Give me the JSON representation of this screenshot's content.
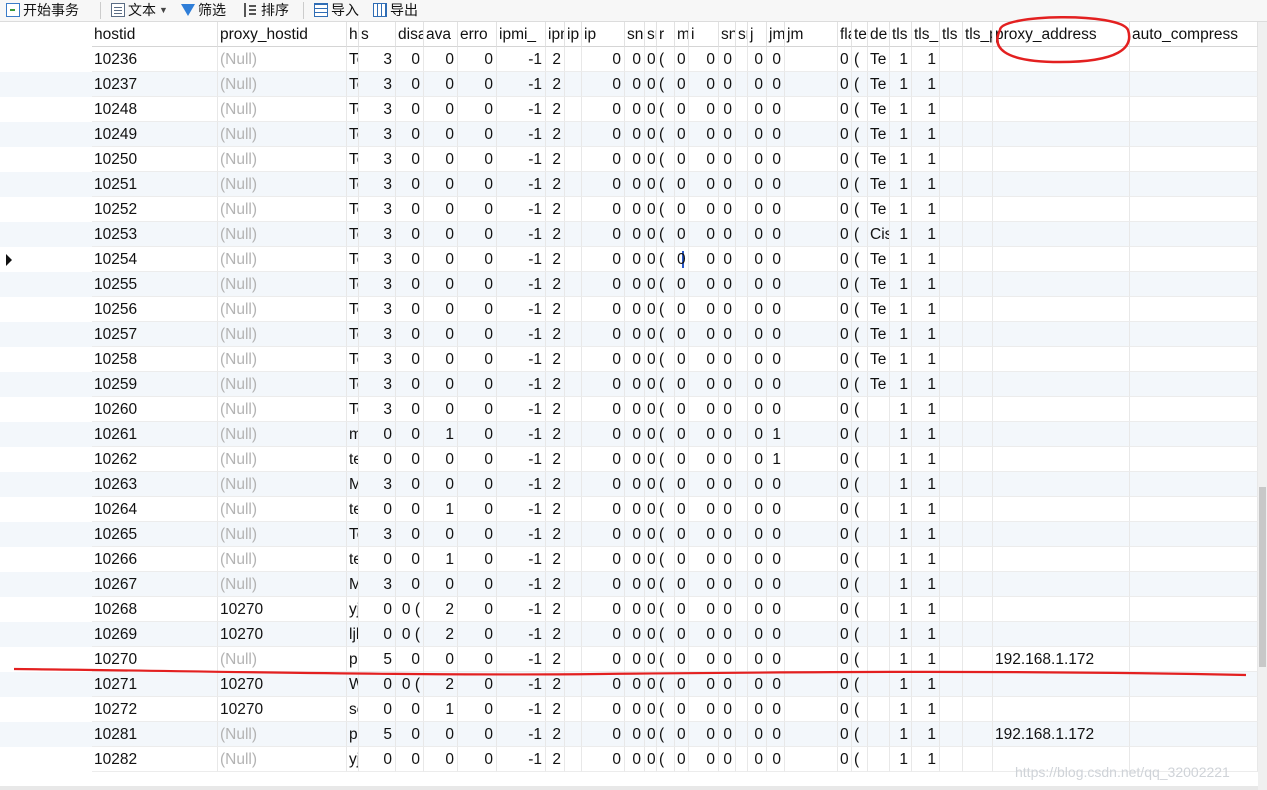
{
  "toolbar": {
    "begin_tx": "开始事务",
    "text": "文本",
    "filter": "筛选",
    "sort": "排序",
    "import": "导入",
    "export": "导出"
  },
  "columns": [
    "hostid",
    "proxy_hostid",
    "host",
    "s",
    "disa",
    "ava",
    "erro",
    "ipmi_",
    "ipmi_p",
    "ip",
    "ip",
    "snmp",
    "sn",
    "r",
    "m",
    "i",
    "snm",
    "sr",
    "j",
    "jm",
    "jm",
    "flag",
    "te",
    "de",
    "tls",
    "tls_",
    "tls",
    "tls_p",
    "proxy_address",
    "auto_compress"
  ],
  "rows": [
    [
      "10236",
      "(Null)",
      "Template Net TP-",
      "3",
      "0",
      "0",
      "0",
      "-1",
      "2",
      "",
      "0",
      "0",
      "0",
      "(",
      "0",
      "0",
      "0",
      "",
      "0",
      "0",
      "",
      "0",
      "(",
      "Te",
      "1",
      "1",
      "",
      "",
      "",
      ""
    ],
    [
      "10237",
      "(Null)",
      "Template Net Ub",
      "3",
      "0",
      "0",
      "0",
      "-1",
      "2",
      "",
      "0",
      "0",
      "0",
      "(",
      "0",
      "0",
      "0",
      "",
      "0",
      "0",
      "",
      "0",
      "(",
      "Te",
      "1",
      "1",
      "",
      "",
      "",
      ""
    ],
    [
      "10248",
      "(Null)",
      "Template OS Linu",
      "3",
      "0",
      "0",
      "0",
      "-1",
      "2",
      "",
      "0",
      "0",
      "0",
      "(",
      "0",
      "0",
      "0",
      "",
      "0",
      "0",
      "",
      "0",
      "(",
      "Te",
      "1",
      "1",
      "",
      "",
      "",
      ""
    ],
    [
      "10249",
      "(Null)",
      "Template OS Win",
      "3",
      "0",
      "0",
      "0",
      "-1",
      "2",
      "",
      "0",
      "0",
      "0",
      "(",
      "0",
      "0",
      "0",
      "",
      "0",
      "0",
      "",
      "0",
      "(",
      "Te",
      "1",
      "1",
      "",
      "",
      "",
      ""
    ],
    [
      "10250",
      "(Null)",
      "Template Net HP",
      "3",
      "0",
      "0",
      "0",
      "-1",
      "2",
      "",
      "0",
      "0",
      "0",
      "(",
      "0",
      "0",
      "0",
      "",
      "0",
      "0",
      "",
      "0",
      "(",
      "Te",
      "1",
      "1",
      "",
      "",
      "",
      ""
    ],
    [
      "10251",
      "(Null)",
      "Template Net Me",
      "3",
      "0",
      "0",
      "0",
      "-1",
      "2",
      "",
      "0",
      "0",
      "0",
      "(",
      "0",
      "0",
      "0",
      "",
      "0",
      "0",
      "",
      "0",
      "(",
      "Te",
      "1",
      "1",
      "",
      "",
      "",
      ""
    ],
    [
      "10252",
      "(Null)",
      "Template Module",
      "3",
      "0",
      "0",
      "0",
      "-1",
      "2",
      "",
      "0",
      "0",
      "0",
      "(",
      "0",
      "0",
      "0",
      "",
      "0",
      "0",
      "",
      "0",
      "(",
      "Te",
      "1",
      "1",
      "",
      "",
      "",
      ""
    ],
    [
      "10253",
      "(Null)",
      "Template Net Cis",
      "3",
      "0",
      "0",
      "0",
      "-1",
      "2",
      "",
      "0",
      "0",
      "0",
      "(",
      "0",
      "0",
      "0",
      "",
      "0",
      "0",
      "",
      "0",
      "(",
      "Cis",
      "1",
      "1",
      "",
      "",
      "",
      ""
    ],
    [
      "10254",
      "(Null)",
      "Template Net Ari",
      "3",
      "0",
      "0",
      "0",
      "-1",
      "2",
      "",
      "0",
      "0",
      "0",
      "(",
      "0",
      "0",
      "0",
      "",
      "0",
      "0",
      "",
      "0",
      "(",
      "Te",
      "1",
      "1",
      "",
      "",
      "",
      ""
    ],
    [
      "10255",
      "(Null)",
      "Template Server I",
      "3",
      "0",
      "0",
      "0",
      "-1",
      "2",
      "",
      "0",
      "0",
      "0",
      "(",
      "0",
      "0",
      "0",
      "",
      "0",
      "0",
      "",
      "0",
      "(",
      "Te",
      "1",
      "1",
      "",
      "",
      "",
      ""
    ],
    [
      "10256",
      "(Null)",
      "Template Server I",
      "3",
      "0",
      "0",
      "0",
      "-1",
      "2",
      "",
      "0",
      "0",
      "0",
      "(",
      "0",
      "0",
      "0",
      "",
      "0",
      "0",
      "",
      "0",
      "(",
      "Te",
      "1",
      "1",
      "",
      "",
      "",
      ""
    ],
    [
      "10257",
      "(Null)",
      "Template Server I",
      "3",
      "0",
      "0",
      "0",
      "-1",
      "2",
      "",
      "0",
      "0",
      "0",
      "(",
      "0",
      "0",
      "0",
      "",
      "0",
      "0",
      "",
      "0",
      "(",
      "Te",
      "1",
      "1",
      "",
      "",
      "",
      ""
    ],
    [
      "10258",
      "(Null)",
      "Template Server I",
      "3",
      "0",
      "0",
      "0",
      "-1",
      "2",
      "",
      "0",
      "0",
      "0",
      "(",
      "0",
      "0",
      "0",
      "",
      "0",
      "0",
      "",
      "0",
      "(",
      "Te",
      "1",
      "1",
      "",
      "",
      "",
      ""
    ],
    [
      "10259",
      "(Null)",
      "Template Server I",
      "3",
      "0",
      "0",
      "0",
      "-1",
      "2",
      "",
      "0",
      "0",
      "0",
      "(",
      "0",
      "0",
      "0",
      "",
      "0",
      "0",
      "",
      "0",
      "(",
      "Te",
      "1",
      "1",
      "",
      "",
      "",
      ""
    ],
    [
      "10260",
      "(Null)",
      "Template App Ap",
      "3",
      "0",
      "0",
      "0",
      "-1",
      "2",
      "",
      "0",
      "0",
      "0",
      "(",
      "0",
      "0",
      "0",
      "",
      "0",
      "0",
      "",
      "0",
      "(",
      "",
      "1",
      "1",
      "",
      "",
      "",
      ""
    ],
    [
      "10261",
      "(Null)",
      "my host",
      "0",
      "0",
      "1",
      "0",
      "-1",
      "2",
      "",
      "0",
      "0",
      "0",
      "(",
      "0",
      "0",
      "0",
      "",
      "0",
      "1",
      "",
      "0",
      "(",
      "",
      "1",
      "1",
      "",
      "",
      "",
      ""
    ],
    [
      "10262",
      "(Null)",
      "test host",
      "0",
      "0",
      "0",
      "0",
      "-1",
      "2",
      "",
      "0",
      "0",
      "0",
      "(",
      "0",
      "0",
      "0",
      "",
      "0",
      "1",
      "",
      "0",
      "(",
      "",
      "1",
      "1",
      "",
      "",
      "",
      ""
    ],
    [
      "10263",
      "(Null)",
      "My Test",
      "3",
      "0",
      "0",
      "0",
      "-1",
      "2",
      "",
      "0",
      "0",
      "0",
      "(",
      "0",
      "0",
      "0",
      "",
      "0",
      "0",
      "",
      "0",
      "(",
      "",
      "1",
      "1",
      "",
      "",
      "",
      ""
    ],
    [
      "10264",
      "(Null)",
      "test sql",
      "0",
      "0",
      "1",
      "0",
      "-1",
      "2",
      "",
      "0",
      "0",
      "0",
      "(",
      "0",
      "0",
      "0",
      "",
      "0",
      "0",
      "",
      "0",
      "(",
      "",
      "1",
      "1",
      "",
      "",
      "",
      ""
    ],
    [
      "10265",
      "(Null)",
      "Template Percon",
      "3",
      "0",
      "0",
      "0",
      "-1",
      "2",
      "",
      "0",
      "0",
      "0",
      "(",
      "0",
      "0",
      "0",
      "",
      "0",
      "0",
      "",
      "0",
      "(",
      "",
      "1",
      "1",
      "",
      "",
      "",
      ""
    ],
    [
      "10266",
      "(Null)",
      "test host my two",
      "0",
      "0",
      "1",
      "0",
      "-1",
      "2",
      "",
      "0",
      "0",
      "0",
      "(",
      "0",
      "0",
      "0",
      "",
      "0",
      "0",
      "",
      "0",
      "(",
      "",
      "1",
      "1",
      "",
      "",
      "",
      ""
    ],
    [
      "10267",
      "(Null)",
      "MS SQL 2012",
      "3",
      "0",
      "0",
      "0",
      "-1",
      "2",
      "",
      "0",
      "0",
      "0",
      "(",
      "0",
      "0",
      "0",
      "",
      "0",
      "0",
      "",
      "0",
      "(",
      "",
      "1",
      "1",
      "",
      "",
      "",
      ""
    ],
    [
      "10268",
      "10270",
      "yjn host",
      "0",
      "0 (",
      "2",
      "0",
      "-1",
      "2",
      "",
      "0",
      "0",
      "0",
      "(",
      "0",
      "0",
      "0",
      "",
      "0",
      "0",
      "",
      "0",
      "(",
      "",
      "1",
      "1",
      "",
      "",
      "",
      ""
    ],
    [
      "10269",
      "10270",
      "ljh host",
      "0",
      "0 (",
      "2",
      "0",
      "-1",
      "2",
      "",
      "0",
      "0",
      "0",
      "(",
      "0",
      "0",
      "0",
      "",
      "0",
      "0",
      "",
      "0",
      "(",
      "",
      "1",
      "1",
      "",
      "",
      "",
      ""
    ],
    [
      "10270",
      "(Null)",
      "proxy007",
      "5",
      "0",
      "0",
      "0",
      "-1",
      "2",
      "",
      "0",
      "0",
      "0",
      "(",
      "0",
      "0",
      "0",
      "",
      "0",
      "0",
      "",
      "0",
      "(",
      "",
      "1",
      "1",
      "",
      "",
      "192.168.1.172",
      ""
    ],
    [
      "10271",
      "10270",
      "Windows",
      "0",
      "0 (",
      "2",
      "0",
      "-1",
      "2",
      "",
      "0",
      "0",
      "0",
      "(",
      "0",
      "0",
      "0",
      "",
      "0",
      "0",
      "",
      "0",
      "(",
      "",
      "1",
      "1",
      "",
      "",
      "",
      ""
    ],
    [
      "10272",
      "10270",
      "server_agent",
      "0",
      "0",
      "1",
      "0",
      "-1",
      "2",
      "",
      "0",
      "0",
      "0",
      "(",
      "0",
      "0",
      "0",
      "",
      "0",
      "0",
      "",
      "0",
      "(",
      "",
      "1",
      "1",
      "",
      "",
      "",
      ""
    ],
    [
      "10281",
      "(Null)",
      "proxy_ljh",
      "5",
      "0",
      "0",
      "0",
      "-1",
      "2",
      "",
      "0",
      "0",
      "0",
      "(",
      "0",
      "0",
      "0",
      "",
      "0",
      "0",
      "",
      "0",
      "(",
      "",
      "1",
      "1",
      "",
      "",
      "192.168.1.172",
      ""
    ],
    [
      "10282",
      "(Null)",
      "yjn agent",
      "0",
      "0",
      "0",
      "0",
      "-1",
      "2",
      "",
      "0",
      "0",
      "0",
      "(",
      "0",
      "0",
      "0",
      "",
      "0",
      "0",
      "",
      "0",
      "(",
      "",
      "1",
      "1",
      "",
      "",
      "",
      ""
    ]
  ],
  "watermark": "https://blog.csdn.net/qq_32002221",
  "colors": {
    "annotation": "#e32020",
    "null_text": "#b3b3b3"
  }
}
